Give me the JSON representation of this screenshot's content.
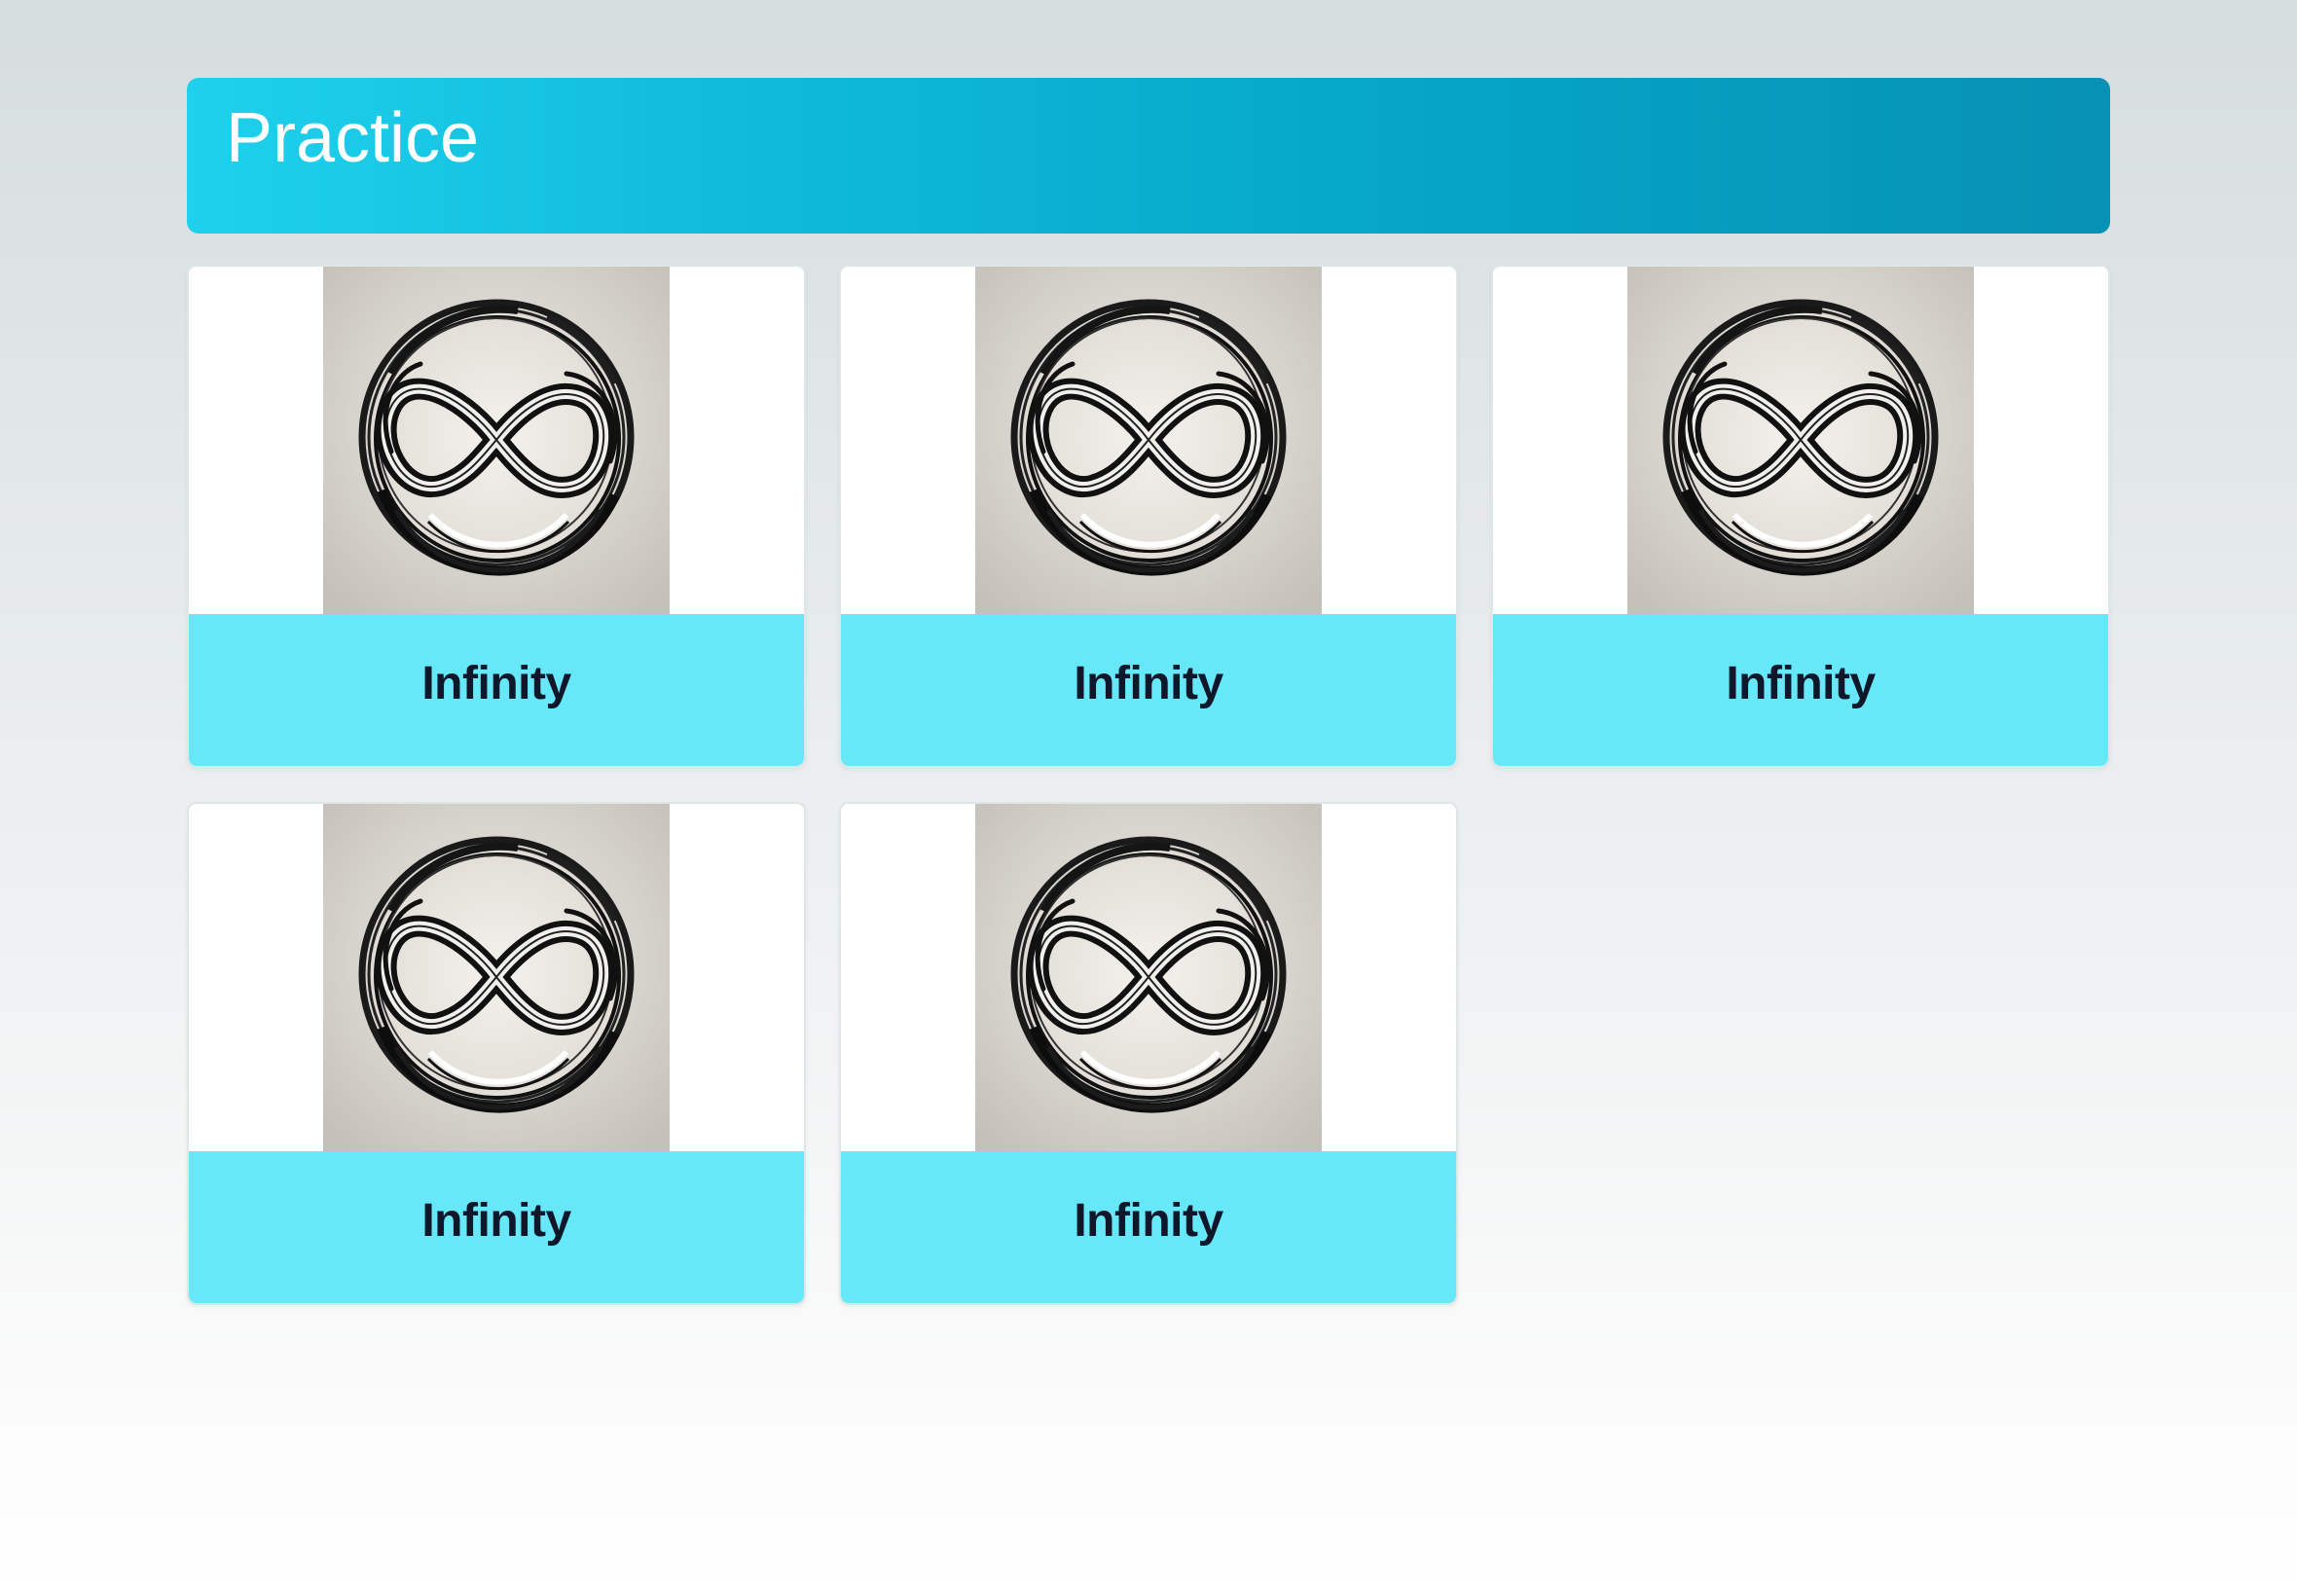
{
  "header": {
    "title": "Practice"
  },
  "cards": [
    {
      "label": "Infinity",
      "image_icon": "infinity-symbol-image"
    },
    {
      "label": "Infinity",
      "image_icon": "infinity-symbol-image"
    },
    {
      "label": "Infinity",
      "image_icon": "infinity-symbol-image"
    },
    {
      "label": "Infinity",
      "image_icon": "infinity-symbol-image"
    },
    {
      "label": "Infinity",
      "image_icon": "infinity-symbol-image"
    }
  ],
  "colors": {
    "header_gradient_start": "#1fd1ec",
    "header_gradient_end": "#0791b5",
    "card_label_background": "#67e8f9",
    "card_label_text": "#0f172a",
    "image_background": "#cfcbc5"
  }
}
